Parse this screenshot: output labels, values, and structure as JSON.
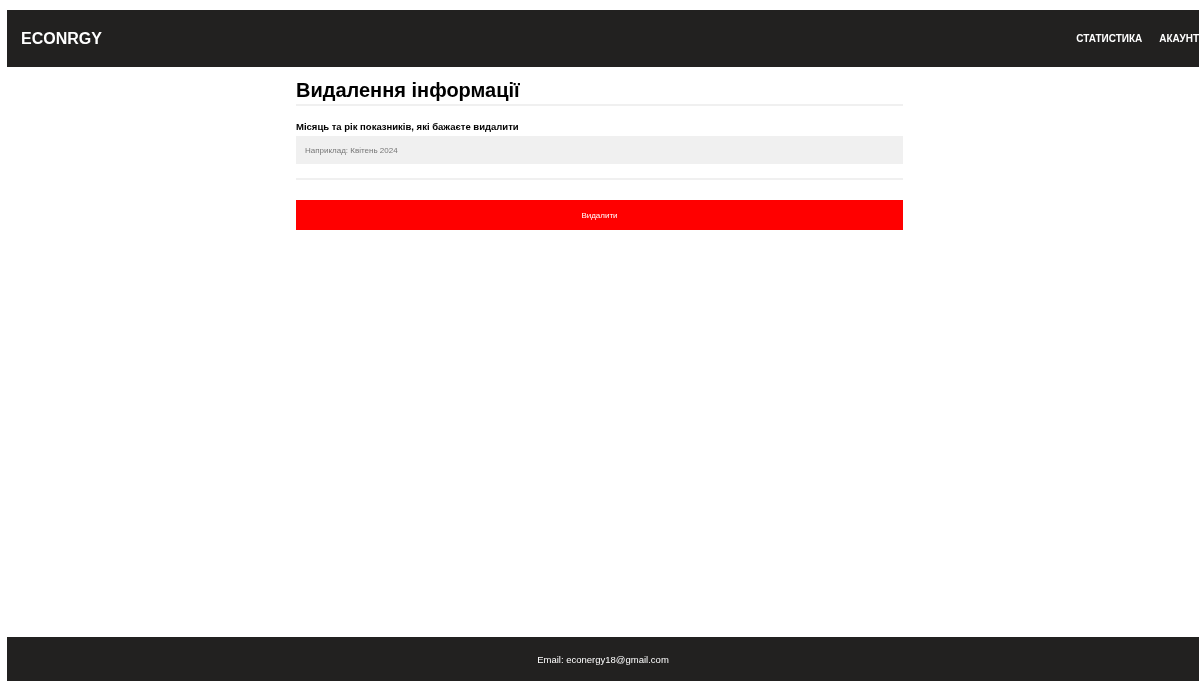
{
  "header": {
    "logo": "ECONRGY",
    "nav": [
      "СТАТИСТИКА",
      "АКАУНТ"
    ]
  },
  "form": {
    "title": "Видалення інформації",
    "field_label": "Місяць та рік показників, які бажаєте видалити",
    "placeholder": "Наприклад: Квітень 2024",
    "submit": "Видалити"
  },
  "footer": {
    "text": "Email: econergy18@gmail.com"
  }
}
